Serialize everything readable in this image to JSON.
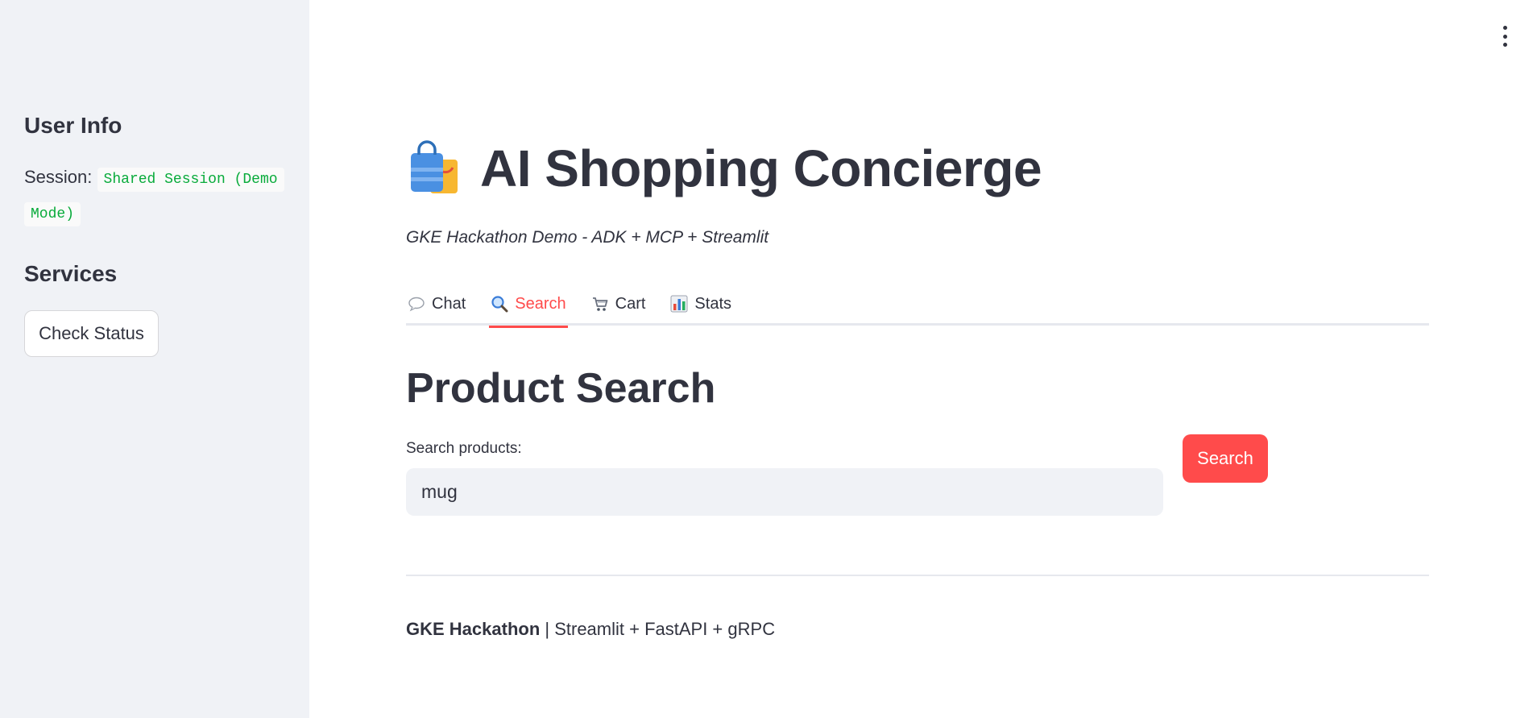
{
  "sidebar": {
    "user_info_heading": "User Info",
    "session_label": "Session:",
    "session_value": "Shared Session (Demo Mode)",
    "services_heading": "Services",
    "check_status_label": "Check Status"
  },
  "header": {
    "title_icon": "shopping-bags-icon",
    "title": "AI Shopping Concierge",
    "subtitle": "GKE Hackathon Demo - ADK + MCP + Streamlit"
  },
  "tabs": [
    {
      "icon": "speech-balloon-icon",
      "label": "Chat",
      "active": false
    },
    {
      "icon": "magnifier-icon",
      "label": "Search",
      "active": true
    },
    {
      "icon": "shopping-cart-icon",
      "label": "Cart",
      "active": false
    },
    {
      "icon": "bar-chart-icon",
      "label": "Stats",
      "active": false
    }
  ],
  "search_section": {
    "heading": "Product Search",
    "input_label": "Search products:",
    "input_value": "mug",
    "button_label": "Search"
  },
  "footer": {
    "bold": "GKE Hackathon",
    "rest": " | Streamlit + FastAPI + gRPC"
  },
  "colors": {
    "accent": "#ff4b4b",
    "sidebar_bg": "#f0f2f6",
    "text": "#31333f",
    "code_text": "#09ab3b"
  }
}
